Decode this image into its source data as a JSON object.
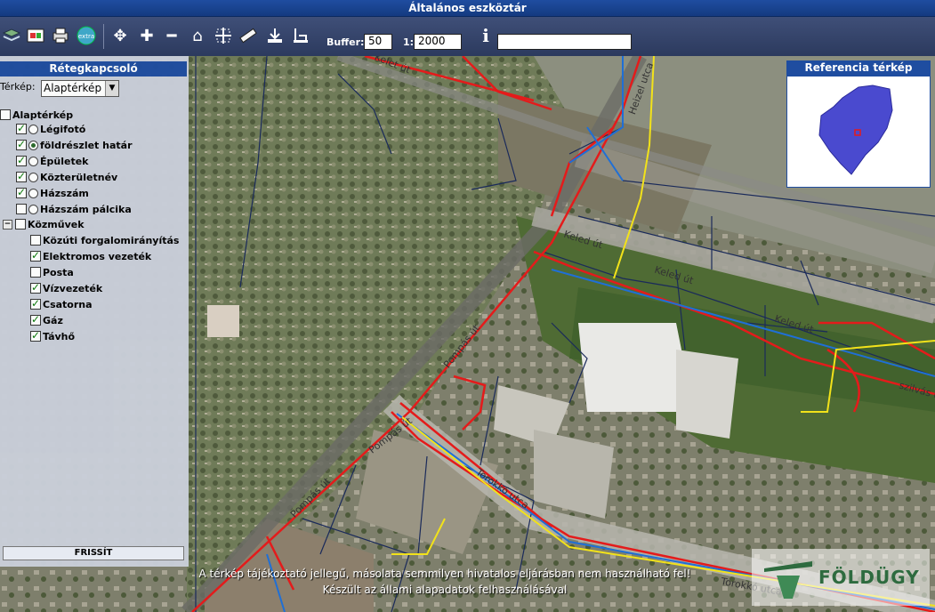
{
  "window": {
    "title": "Általános eszköztár"
  },
  "toolbar": {
    "buffer_label": "Buffer:",
    "buffer_value": "50",
    "scale_label": "1:",
    "scale_value": "2000",
    "info_icon": "info-icon",
    "search_value": ""
  },
  "layer_panel": {
    "title": "Rétegkapcsoló",
    "map_label": "Térkép:",
    "map_selected": "Alaptérkép",
    "groups": [
      {
        "label": "Alaptérkép",
        "checked": false
      },
      {
        "label": "Légifotó",
        "checked": true,
        "radio": false
      },
      {
        "label": "földrészlet határ",
        "checked": true,
        "radio": true
      },
      {
        "label": "Épületek",
        "checked": true,
        "radio": false
      },
      {
        "label": "Közterületnév",
        "checked": true,
        "radio": false
      },
      {
        "label": "Házszám",
        "checked": true,
        "radio": false
      },
      {
        "label": "Házszám pálcika",
        "checked": false,
        "radio": false
      },
      {
        "label": "Közművek",
        "checked": false
      },
      {
        "label": "Közúti forgalomirányítás",
        "checked": false
      },
      {
        "label": "Elektromos vezeték",
        "checked": true
      },
      {
        "label": "Posta",
        "checked": false
      },
      {
        "label": "Vízvezeték",
        "checked": true
      },
      {
        "label": "Csatorna",
        "checked": true
      },
      {
        "label": "Gáz",
        "checked": true
      },
      {
        "label": "Távhő",
        "checked": true
      }
    ],
    "refresh_label": "FRISSÍT"
  },
  "reference_map": {
    "title": "Referencia térkép"
  },
  "map": {
    "streets": [
      "Kelet út",
      "Keled út",
      "Keled út",
      "Keled út",
      "Pompás út",
      "Pompás út",
      "Pompás út",
      "Torokkó utca",
      "Torokkó utca",
      "Heizel utca",
      "szilvás út"
    ],
    "disclaimer_line1": "A térkép tájékoztató jellegű, másolata semmilyen hivatalos eljárásban nem használható fel!",
    "disclaimer_line2": "Készült az állami alapadatok felhasználásával",
    "logo_text": "FÖLDÜGY"
  },
  "colors": {
    "accent": "#1f4da0",
    "electric": "#e41b1b",
    "water": "#1f6fd6",
    "gas": "#f2e21a"
  }
}
